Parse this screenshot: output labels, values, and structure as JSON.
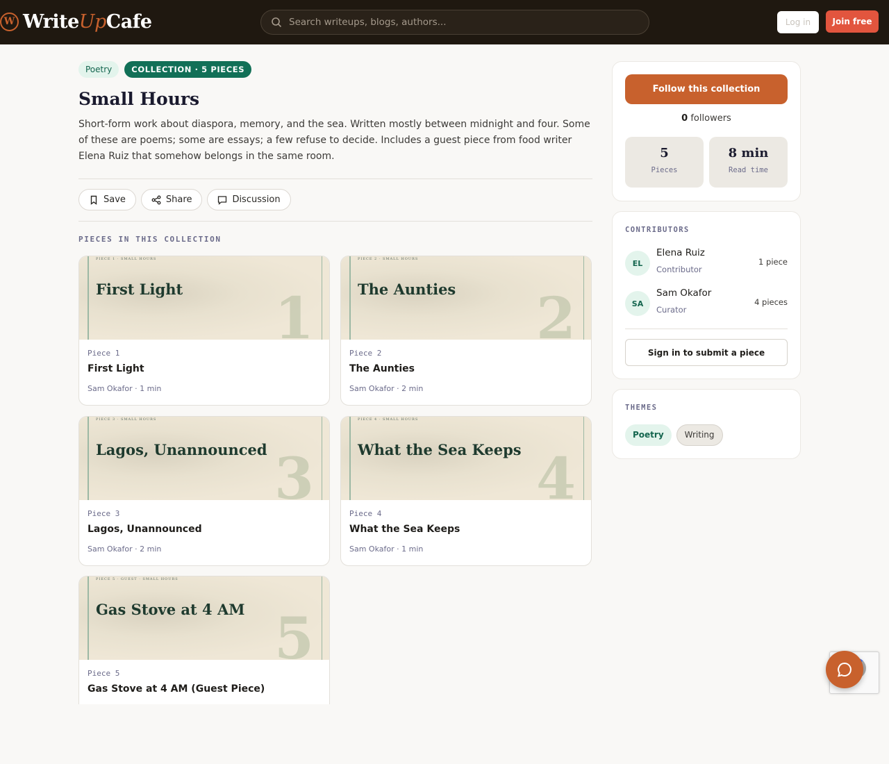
{
  "header": {
    "logo": {
      "mark": "W",
      "text_pre": "Write",
      "text_up": "Up",
      "text_post": "Cafe"
    },
    "search_placeholder": "Search writeups, blogs, authors...",
    "login_label": "Log in",
    "join_label": "Join free"
  },
  "collection": {
    "tag_category": "Poetry",
    "tag_collection": "COLLECTION · 5 PIECES",
    "title": "Small Hours",
    "description": "Short-form work about diaspora, memory, and the sea. Written mostly between midnight and four. Some of these are poems; some are essays; a few refuse to decide. Includes a guest piece from food writer Elena Ruiz that somehow belongs in the same room.",
    "actions": {
      "save": "Save",
      "share": "Share",
      "discussion": "Discussion"
    },
    "section_label": "PIECES IN THIS COLLECTION",
    "pieces": [
      {
        "kicker": "PIECE 1 · SMALL HOURS",
        "cover_title": "First Light",
        "big_number": "1",
        "piece_label": "Piece 1",
        "title": "First Light",
        "meta": "Sam Okafor · 1 min"
      },
      {
        "kicker": "PIECE 2 · SMALL HOURS",
        "cover_title": "The Aunties",
        "big_number": "2",
        "piece_label": "Piece 2",
        "title": "The Aunties",
        "meta": "Sam Okafor · 2 min"
      },
      {
        "kicker": "PIECE 3 · SMALL HOURS",
        "cover_title": "Lagos, Unannounced",
        "big_number": "3",
        "piece_label": "Piece 3",
        "title": "Lagos, Unannounced",
        "meta": "Sam Okafor · 2 min"
      },
      {
        "kicker": "PIECE 4 · SMALL HOURS",
        "cover_title": "What the Sea Keeps",
        "big_number": "4",
        "piece_label": "Piece 4",
        "title": "What the Sea Keeps",
        "meta": "Sam Okafor · 1 min"
      },
      {
        "kicker": "PIECE 5 · GUEST · SMALL HOURS",
        "cover_title": "Gas Stove at 4 AM",
        "big_number": "5",
        "piece_label": "Piece 5",
        "title": "Gas Stove at 4 AM (Guest Piece)",
        "meta": ""
      }
    ]
  },
  "sidebar": {
    "follow_label": "Follow this collection",
    "followers_count": "0",
    "followers_label": "followers",
    "stats": [
      {
        "value": "5",
        "label": "Pieces"
      },
      {
        "value": "8 min",
        "label": "Read time"
      }
    ],
    "contributors_label": "CONTRIBUTORS",
    "contributors": [
      {
        "initials": "EL",
        "name": "Elena Ruiz",
        "role": "Contributor",
        "count": "1 piece"
      },
      {
        "initials": "SA",
        "name": "Sam Okafor",
        "role": "Curator",
        "count": "4 pieces"
      }
    ],
    "submit_label": "Sign in to submit a piece",
    "themes_label": "THEMES",
    "themes": [
      "Poetry",
      "Writing"
    ]
  },
  "colors": {
    "header_bg": "#1f1810",
    "accent": "#c8612d",
    "join": "#e2553e",
    "green": "#127057"
  }
}
